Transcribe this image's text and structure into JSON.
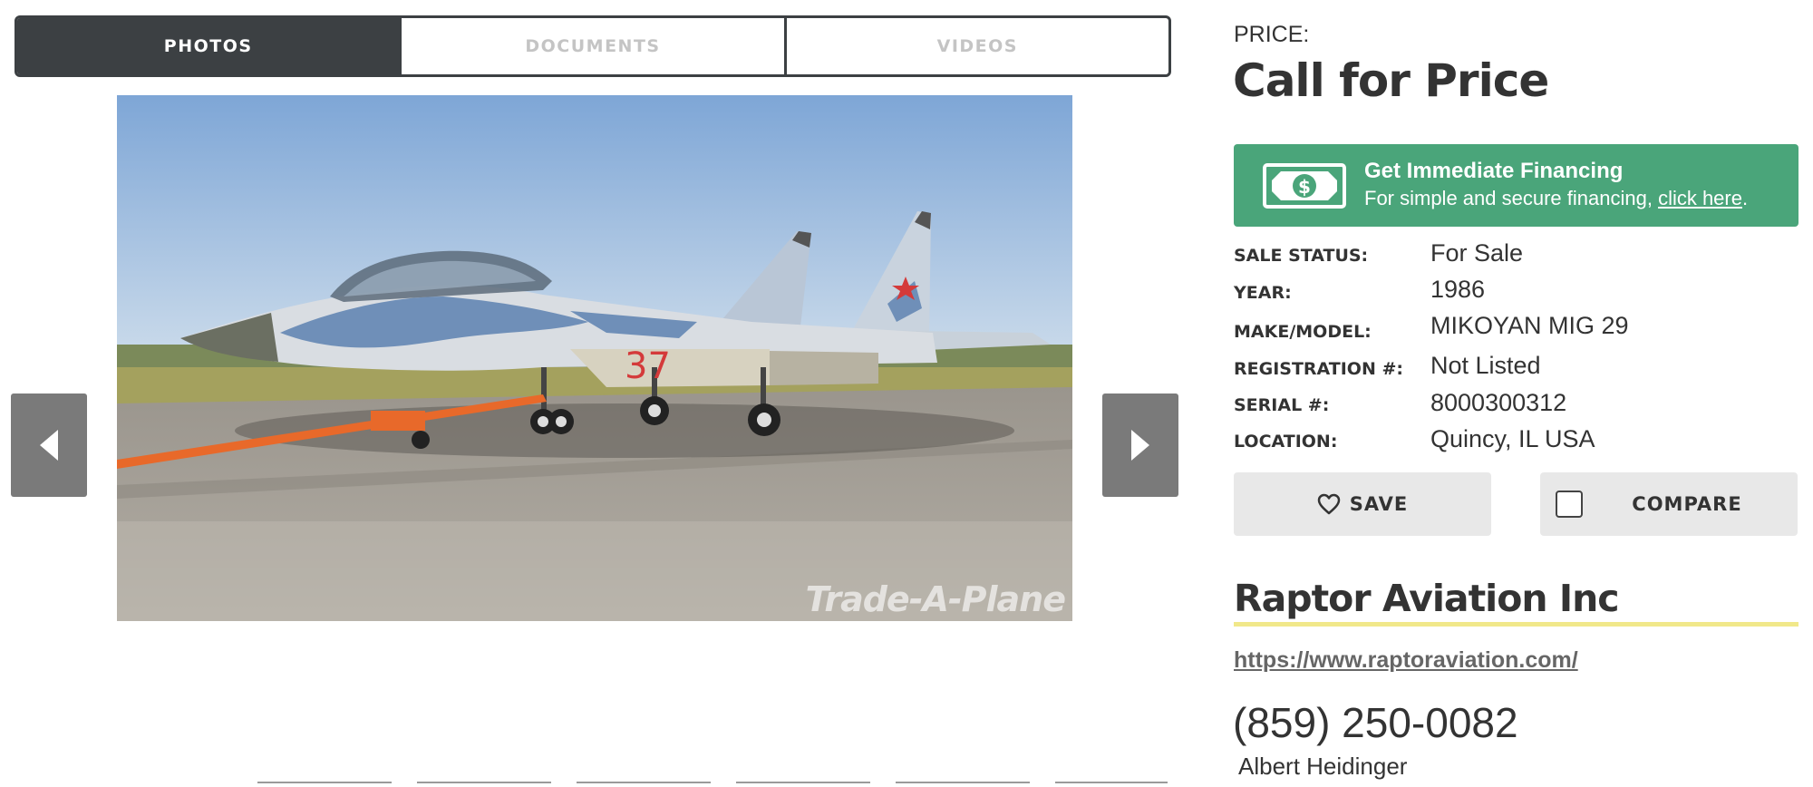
{
  "tabs": [
    {
      "label": "PHOTOS",
      "active": true
    },
    {
      "label": "DOCUMENTS",
      "active": false
    },
    {
      "label": "VIDEOS",
      "active": false
    }
  ],
  "gallery": {
    "watermark": "Trade-A-Plane",
    "tail_number": "37",
    "prev_icon": "chevron-left-icon",
    "next_icon": "chevron-right-icon"
  },
  "price": {
    "label": "PRICE:",
    "value": "Call for Price"
  },
  "financing": {
    "icon": "cash-icon",
    "title": "Get Immediate Financing",
    "text": "For simple and secure financing, ",
    "link": "click here",
    "suffix": "."
  },
  "specs": [
    {
      "label": "SALE STATUS:",
      "value": "For Sale"
    },
    {
      "label": "YEAR:",
      "value": "1986"
    },
    {
      "label": "MAKE/MODEL:",
      "value": "MIKOYAN MIG 29"
    },
    {
      "label": "REGISTRATION #:",
      "value": "Not Listed"
    },
    {
      "label": "SERIAL #:",
      "value": "8000300312"
    },
    {
      "label": "LOCATION:",
      "value": "Quincy, IL USA"
    }
  ],
  "actions": {
    "save_label": "SAVE",
    "save_icon": "heart-icon",
    "compare_label": "COMPARE",
    "compare_checked": false
  },
  "dealer": {
    "name": "Raptor Aviation Inc",
    "url": "https://www.raptoraviation.com/",
    "phone": "(859) 250-0082",
    "contact": "Albert Heidinger"
  },
  "colors": {
    "tab_active": "#3c4043",
    "financing_green": "#4aa57a",
    "dealer_underline": "#f1e88a",
    "button_gray": "#e8e8e8"
  }
}
